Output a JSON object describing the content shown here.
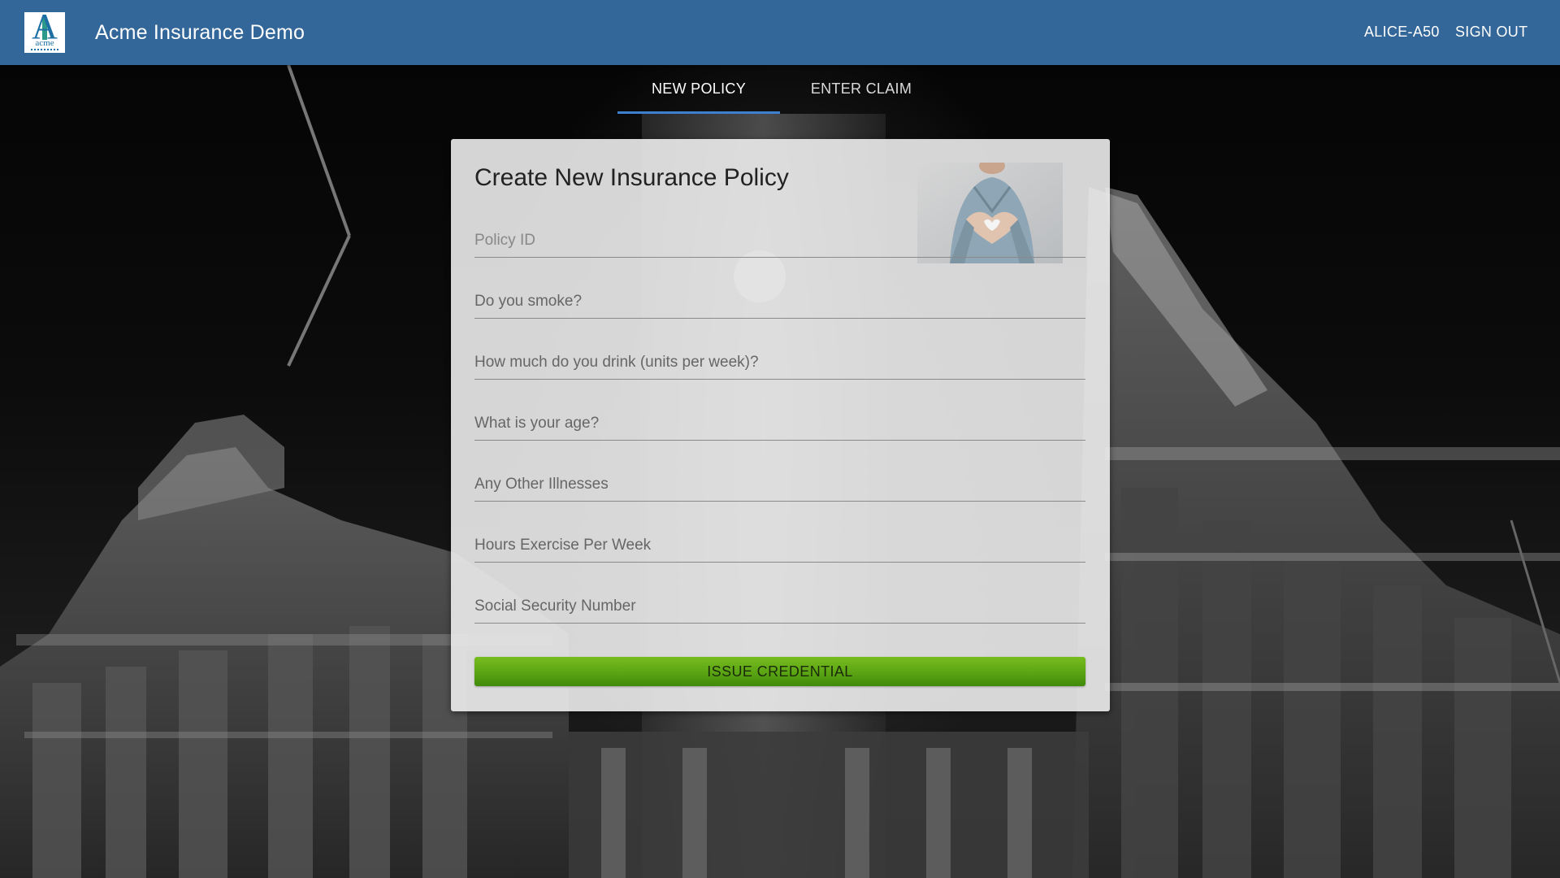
{
  "app": {
    "title": "Acme Insurance Demo",
    "logo_letter": "A",
    "logo_word": "acme",
    "user": "ALICE-A50",
    "sign_out": "SIGN OUT",
    "brand_color": "#336699"
  },
  "tabs": [
    {
      "label": "NEW POLICY",
      "active": true
    },
    {
      "label": "ENTER CLAIM",
      "active": false
    }
  ],
  "form": {
    "title": "Create New Insurance Policy",
    "photo_icon": "nurse-heart-hands-photo",
    "fields": [
      {
        "placeholder": "Policy ID",
        "value": ""
      },
      {
        "placeholder": "Do you smoke?",
        "value": ""
      },
      {
        "placeholder": "How much do you drink (units per week)?",
        "value": ""
      },
      {
        "placeholder": "What is your age?",
        "value": ""
      },
      {
        "placeholder": "Any Other Illnesses",
        "value": ""
      },
      {
        "placeholder": "Hours Exercise Per Week",
        "value": ""
      },
      {
        "placeholder": "Social Security Number",
        "value": ""
      }
    ],
    "submit_label": "ISSUE CREDENTIAL",
    "submit_color": "#5aa414"
  }
}
